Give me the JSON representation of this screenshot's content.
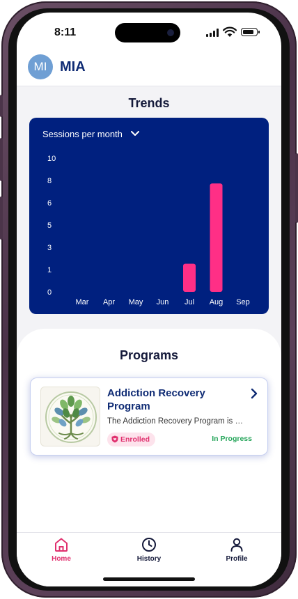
{
  "status_bar": {
    "time": "8:11",
    "battery_level": 0.85
  },
  "header": {
    "avatar_initials": "MI",
    "app_name": "MIA"
  },
  "trends": {
    "title": "Trends",
    "selector_label": "Sessions per month"
  },
  "chart_data": {
    "type": "bar",
    "categories": [
      "Mar",
      "Apr",
      "May",
      "Jun",
      "Jul",
      "Aug",
      "Sep"
    ],
    "values": [
      0,
      0,
      0,
      0,
      2,
      8,
      0
    ],
    "y_ticks": [
      "0",
      "1",
      "3",
      "5",
      "6",
      "8",
      "10"
    ],
    "ylim": [
      0,
      10
    ],
    "bar_color": "#ff2f86",
    "background": "#00207f",
    "grid": false
  },
  "programs": {
    "title": "Programs",
    "items": [
      {
        "title": "Addiction Recovery Program",
        "description": "The Addiction Recovery Program is designed to help",
        "badge": "Enrolled",
        "status": "In Progress",
        "image_icon": "tree-of-life-icon"
      }
    ]
  },
  "tabs": [
    {
      "label": "Home",
      "icon": "home-icon",
      "active": true
    },
    {
      "label": "History",
      "icon": "clock-icon",
      "active": false
    },
    {
      "label": "Profile",
      "icon": "user-icon",
      "active": false
    }
  ],
  "colors": {
    "brand_navy": "#0f2b74",
    "accent_pink": "#e0306e",
    "success_green": "#26a65b"
  }
}
